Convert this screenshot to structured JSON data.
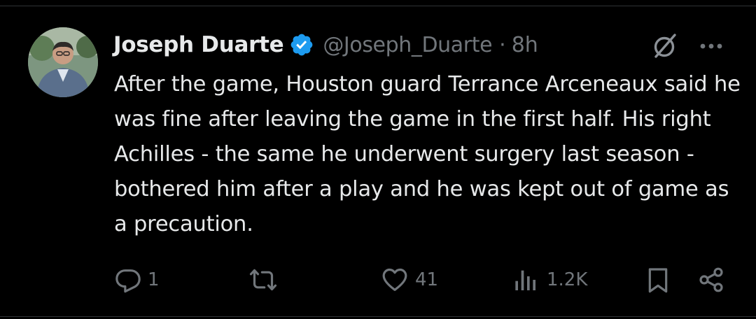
{
  "tweet": {
    "author": {
      "display_name": "Joseph Duarte",
      "handle": "@Joseph_Duarte",
      "verified": true
    },
    "separator": "·",
    "time_ago": "8h",
    "text": "After the game, Houston guard Terrance Arceneaux said he was fine after leaving the game in the first half. His right Achilles - the same he underwent surgery last season - bothered him after a play and he was kept out of game as a precaution.",
    "icons": {
      "header_right": [
        "grok-icon",
        "more-options-icon"
      ],
      "actions": [
        "reply-icon",
        "repost-icon",
        "like-icon",
        "views-icon",
        "bookmark-icon",
        "share-icon"
      ]
    },
    "stats": {
      "replies": "1",
      "reposts": "",
      "likes": "41",
      "views": "1.2K"
    }
  },
  "colors": {
    "background": "#000000",
    "text_primary": "#e7e9ea",
    "text_secondary": "#71767b",
    "verified_blue": "#1d9bf0",
    "divider": "#2f3336"
  }
}
